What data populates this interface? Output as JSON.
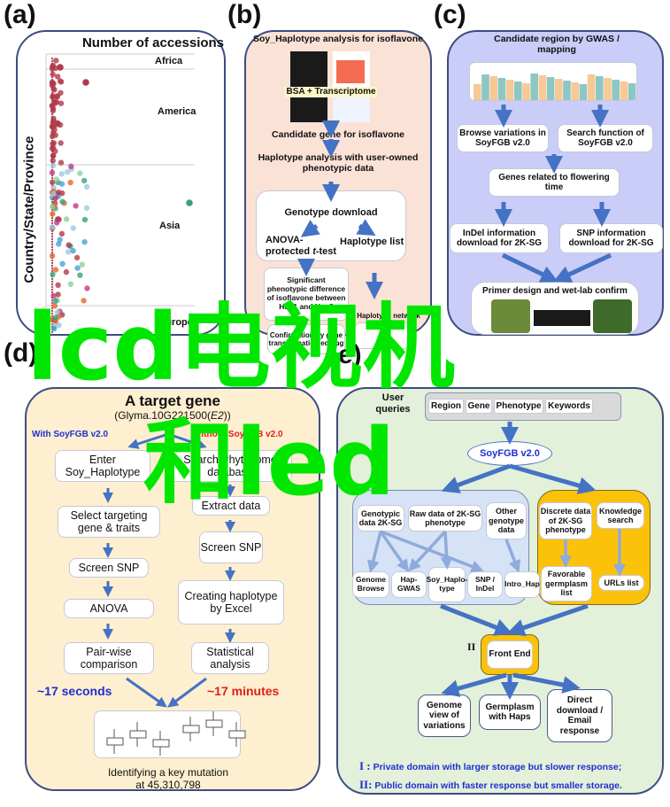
{
  "panels": {
    "a": {
      "label": "(a)",
      "title": "Number of accessions",
      "ylabel": "Country/State/Province",
      "regions": [
        "Africa",
        "America",
        "Asia",
        "Europe"
      ]
    },
    "b": {
      "label": "(b)",
      "title": "Soy_Haplotype analysis for isoflavone",
      "image_caption": "BSA + Transcriptome",
      "step1": "Candidate gene for isoflavone",
      "step2": "Haplotype analysis with user-owned phenotypic data",
      "genotype_download": "Genotype download",
      "anova": "ANOVA-protected t-test",
      "anova_line1": "ANOVA-",
      "anova_line2a": "protected ",
      "anova_line2b": "t",
      "anova_line2c": "-test",
      "haplotype_list": "Haplotype list",
      "significant": "Significant phenotypic difference of isoflavone between Hap1 and Hap2",
      "haplotype_network": "Haplotype network",
      "confirmation": "Confirmation by gene transformation editing"
    },
    "c": {
      "label": "(c)",
      "title": "Candidate region by GWAS / mapping",
      "browse": "Browse variations in SoyFGB v2.0",
      "search": "Search function of SoyFGB v2.0",
      "genes": "Genes related to flowering time",
      "indel": "InDel information download for 2K-SG",
      "snp": "SNP information download for 2K-SG",
      "primer": "Primer design and wet-lab confirm"
    },
    "d": {
      "label": "(d)",
      "title": "A target gene",
      "gene_prefix": "(Glyma.10G221500(",
      "gene_italic": "E2",
      "gene_suffix": "))",
      "with_label": "With SoyFGB v2.0",
      "without_label": "Without SoyFGB v2.0",
      "with_steps": [
        "Enter Soy_Haplotype",
        "Select targeting gene & traits",
        "Screen SNP",
        "ANOVA",
        "Pair-wise comparison"
      ],
      "without_steps": [
        "Search Phytozome database",
        "Extract data",
        "Screen SNP",
        "Creating haplotype by Excel",
        "Statistical analysis"
      ],
      "time_with": "~17 seconds",
      "time_without": "~17 minutes",
      "result_line1": "Identifying a key mutation",
      "result_line2": "at 45,310,798"
    },
    "e": {
      "label": "(e)",
      "user_queries": "User queries",
      "query_tabs": [
        "Region",
        "Gene",
        "Phenotype",
        "Keywords"
      ],
      "core": "SoyFGB v2.0",
      "private_items": [
        "Genotypic data 2K-SG",
        "Raw data of 2K-SG phenotype",
        "Other genotype data"
      ],
      "private_tools": [
        "Genome Browse",
        "Hap-GWAS",
        "Soy_Haplo-type",
        "SNP / InDel",
        "Intro_Hap"
      ],
      "public_items": [
        "Discrete data of 2K-SG phenotype",
        "Knowledge search"
      ],
      "public_tools": [
        "Favorable germplasm list",
        "URLs list"
      ],
      "roman_two": "II",
      "front_end": "Front End",
      "outputs": [
        "Genome view of variations",
        "Germplasm with Haps",
        "Direct download / Email response"
      ],
      "legend1_mark": "I :",
      "legend1": "Private domain with larger storage but slower response;",
      "legend2_mark": "II:",
      "legend2": "Public domain with faster response but smaller storage."
    }
  },
  "overlay": {
    "line1": "lcd电视机",
    "line2": "和led"
  },
  "colors": {
    "panel_b_bg": "#fbe2d6",
    "panel_c_bg": "#c9cdf7",
    "panel_d_bg": "#fdefd0",
    "panel_e_bg": "#e3f0da",
    "private_bg": "#d6e2f5",
    "public_bg": "#fcc20a",
    "arrow": "#4472c4",
    "with_color": "#1f2fd0",
    "without_color": "#e0201a",
    "overlay": "#00e600"
  }
}
